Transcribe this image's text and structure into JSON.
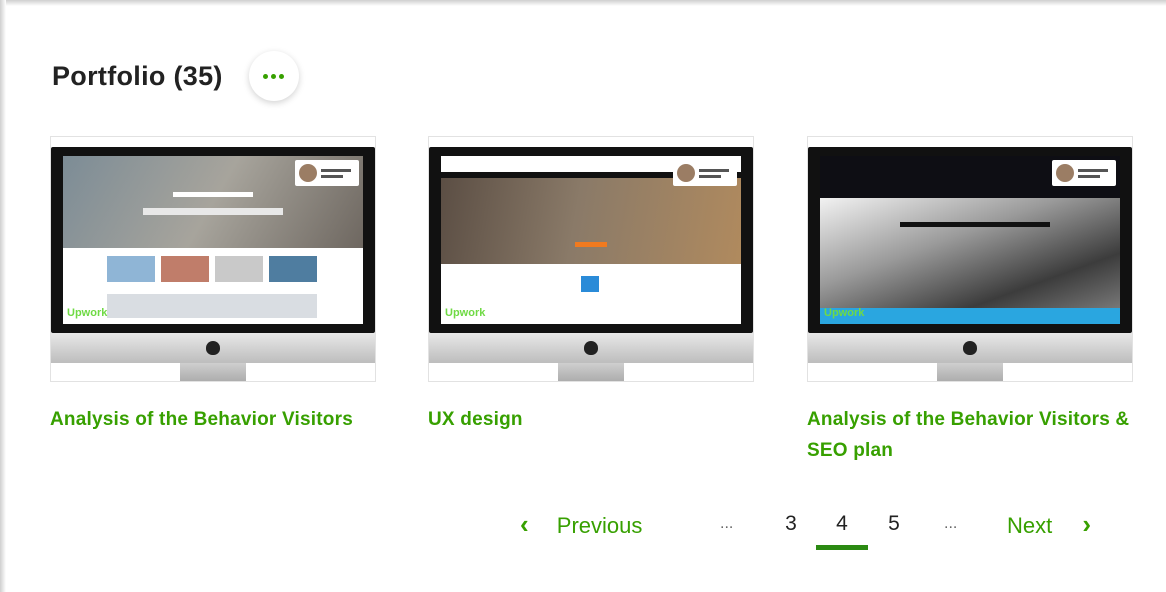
{
  "header": {
    "title": "Portfolio (35)",
    "more_icon": "ellipsis-icon"
  },
  "colors": {
    "accent": "#37a000",
    "active_underline": "#2b8a12",
    "title_text": "#222222"
  },
  "portfolio": {
    "items": [
      {
        "title": "Analysis of the Behavior Visitors",
        "thumbnail_badge": "Upwork"
      },
      {
        "title": "UX design",
        "thumbnail_badge": "Upwork"
      },
      {
        "title": "Analysis of the Behavior Visitors & SEO plan",
        "thumbnail_badge": "Upwork"
      }
    ]
  },
  "pagination": {
    "previous_label": "Previous",
    "next_label": "Next",
    "ellipsis": "...",
    "pages": [
      "3",
      "4",
      "5"
    ],
    "current_page": "4",
    "prev_icon": "chevron-left-icon",
    "next_icon": "chevron-right-icon"
  }
}
